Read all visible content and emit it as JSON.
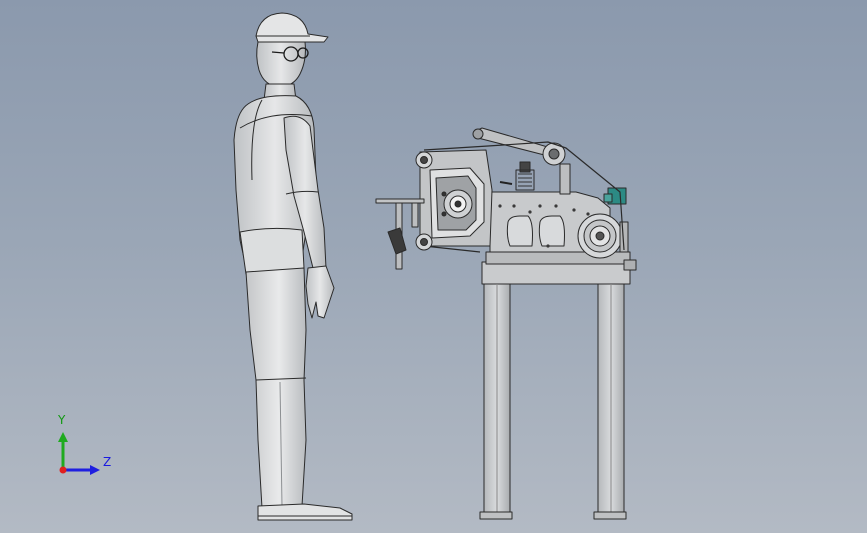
{
  "triad": {
    "y_label": "Y",
    "z_label": "Z",
    "y_color": "#1faa1f",
    "z_color": "#1f1fe0",
    "x_color": "#e01f1f"
  },
  "colors": {
    "background_top": "#8b99ad",
    "background_bottom": "#b3bac4",
    "human_body": "#d4d6d8",
    "machine_body": "#c6c8ca",
    "accent_teal": "#2c8a84",
    "edge": "#2a2a2a"
  }
}
